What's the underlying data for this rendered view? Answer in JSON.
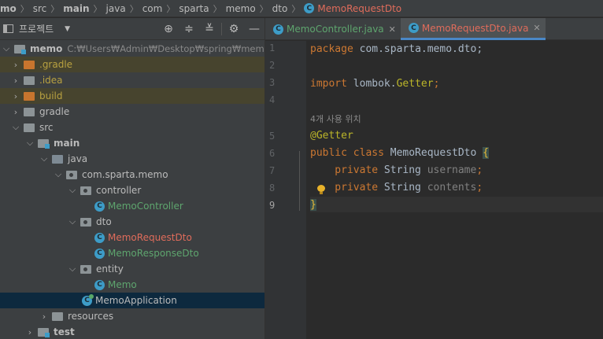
{
  "breadcrumb": {
    "items": [
      "mo",
      "src",
      "main",
      "java",
      "com",
      "sparta",
      "memo",
      "dto"
    ],
    "current": "MemoRequestDto"
  },
  "project_panel": {
    "title": "프로젝트"
  },
  "tree": [
    {
      "label": "memo",
      "path": "C:₩Users₩Admin₩Desktop₩spring₩memo"
    },
    {
      "label": ".gradle"
    },
    {
      "label": ".idea"
    },
    {
      "label": "build"
    },
    {
      "label": "gradle"
    },
    {
      "label": "src"
    },
    {
      "label": "main"
    },
    {
      "label": "java"
    },
    {
      "label": "com.sparta.memo"
    },
    {
      "label": "controller"
    },
    {
      "label": "MemoController"
    },
    {
      "label": "dto"
    },
    {
      "label": "MemoRequestDto"
    },
    {
      "label": "MemoResponseDto"
    },
    {
      "label": "entity"
    },
    {
      "label": "Memo"
    },
    {
      "label": "MemoApplication"
    },
    {
      "label": "resources"
    },
    {
      "label": "test"
    }
  ],
  "tabs": [
    {
      "label": "MemoController.java"
    },
    {
      "label": "MemoRequestDto.java"
    }
  ],
  "editor": {
    "line_numbers": [
      "1",
      "2",
      "3",
      "4",
      "5",
      "6",
      "7",
      "8",
      "9"
    ],
    "usage_hint": "4개 사용 위치",
    "code": {
      "l1_kw": "package",
      "l1_rest": " com.sparta.memo.dto;",
      "l3_kw": "import",
      "l3_rest": " lombok.",
      "l3_ann": "Getter",
      "l3_end": ";",
      "l5_ann": "@Getter",
      "l6_kw": "public class",
      "l6_name": " MemoRequestDto ",
      "l6_brace": "{",
      "l7_kw": "    private",
      "l7_type": " String ",
      "l7_field": "username",
      "l7_end": ";",
      "l8_kw": "    private",
      "l8_type": " String ",
      "l8_field": "contents",
      "l8_end": ";",
      "l9_brace": "}"
    }
  }
}
